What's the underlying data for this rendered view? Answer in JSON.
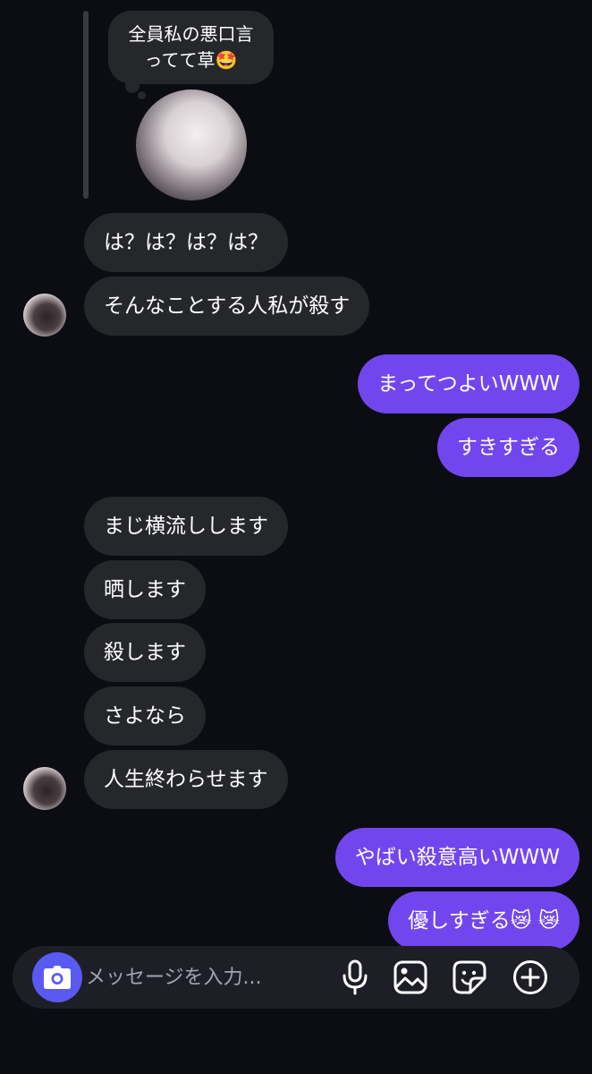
{
  "story_reply": {
    "caption": "全員私の悪口言ってて草🤩",
    "thumbnail_alt": "story-image"
  },
  "messages": [
    {
      "side": "in",
      "text": "は？は？は？は？"
    },
    {
      "side": "in",
      "text": "そんなことする人私が殺す"
    },
    {
      "side": "out",
      "text": "まってつよいWWW"
    },
    {
      "side": "out",
      "text": "すきすぎる"
    },
    {
      "side": "in",
      "text": "まじ横流しします"
    },
    {
      "side": "in",
      "text": "晒します"
    },
    {
      "side": "in",
      "text": "殺します"
    },
    {
      "side": "in",
      "text": "さよなら"
    },
    {
      "side": "in",
      "text": "人生終わらせます"
    },
    {
      "side": "out",
      "text": "やばい殺意高いWWW"
    },
    {
      "side": "out",
      "text": "優しすぎる😿 😿"
    }
  ],
  "composer": {
    "placeholder": "メッセージを入力...",
    "value": "",
    "icons": [
      "camera-icon",
      "microphone-icon",
      "image-icon",
      "sticker-icon",
      "plus-icon"
    ]
  },
  "colors": {
    "background": "#0c0d12",
    "incoming_bubble": "#26272b",
    "outgoing_bubble": "#7246ef",
    "camera_button": "#5a5af2"
  }
}
